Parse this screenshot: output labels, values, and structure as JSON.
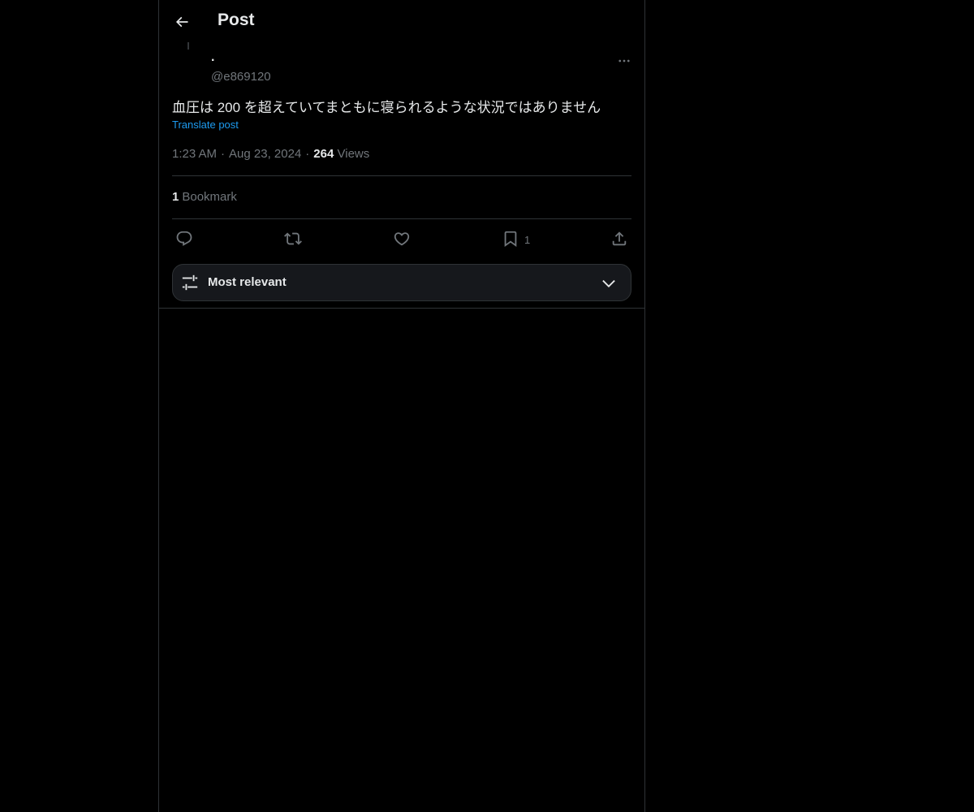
{
  "header": {
    "title": "Post",
    "back_icon": "arrow-left-icon"
  },
  "author": {
    "name": ".",
    "handle": "@e869120",
    "more_icon": "ellipsis-icon"
  },
  "post": {
    "text": "血圧は 200 を超えていてまともに寝られるような状況ではありません",
    "translate_label": "Translate post",
    "time": "1:23 AM",
    "date": "Aug 23, 2024",
    "views_count": "264",
    "views_label": "Views"
  },
  "stats": {
    "bookmarks_count": "1",
    "bookmarks_label": "Bookmark"
  },
  "actions": {
    "reply_icon": "reply-icon",
    "repost_icon": "repost-icon",
    "like_icon": "heart-icon",
    "bookmark_icon": "bookmark-icon",
    "bookmark_count": "1",
    "share_icon": "share-icon"
  },
  "replies_sort": {
    "label": "Most relevant",
    "icon": "sliders-icon",
    "chevron": "chevron-down-icon"
  },
  "colors": {
    "background": "#000000",
    "text": "#e7e9ea",
    "muted": "#71767b",
    "accent": "#1d9bf0",
    "border": "#2f3336"
  }
}
